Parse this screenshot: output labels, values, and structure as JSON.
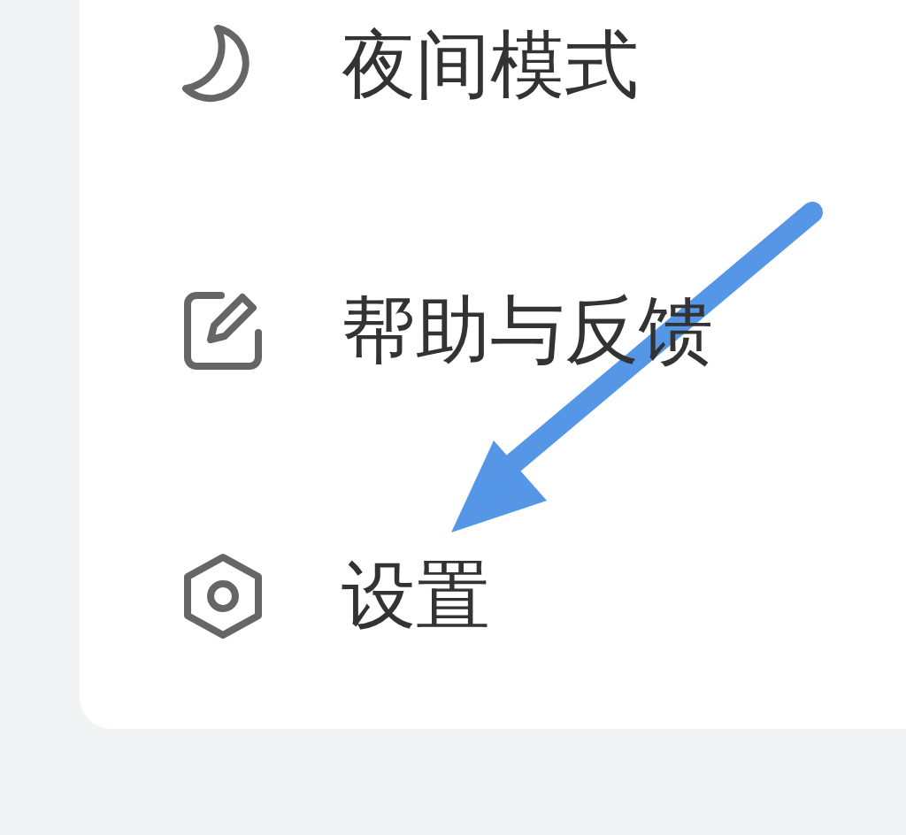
{
  "menu": {
    "items": [
      {
        "kind": "moon",
        "label": "夜间模式"
      },
      {
        "kind": "edit",
        "label": "帮助与反馈"
      },
      {
        "kind": "settings",
        "label": "设置"
      }
    ]
  },
  "annotation": {
    "kind": "arrow",
    "color": "#5596e6"
  }
}
